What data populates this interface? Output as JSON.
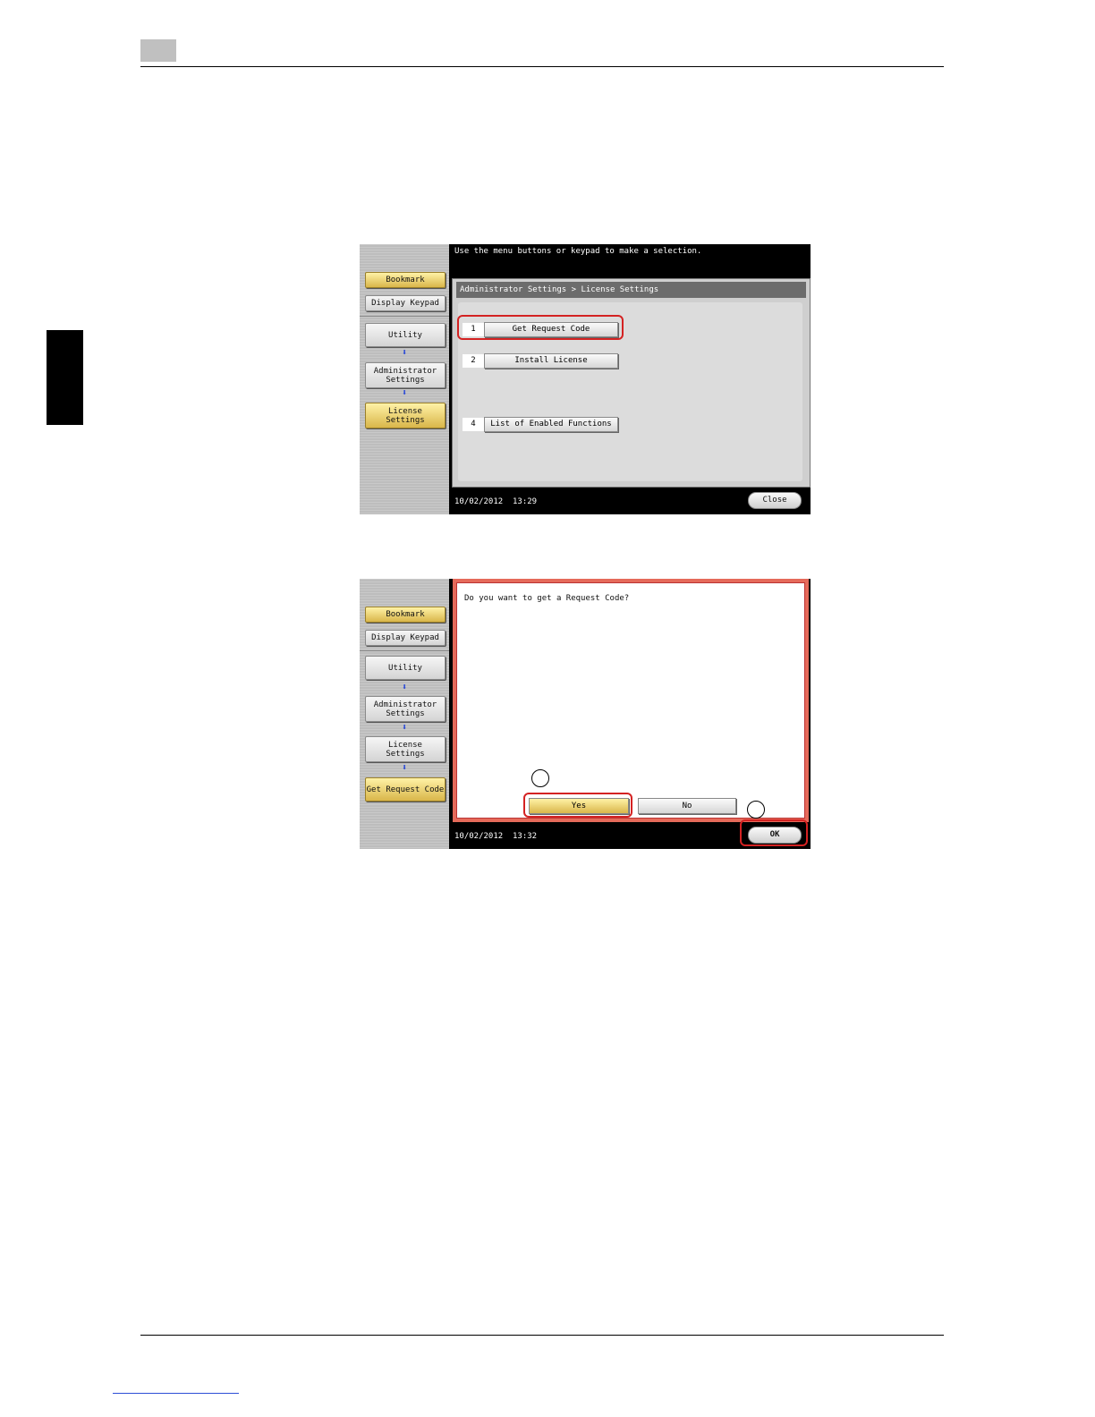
{
  "screen1": {
    "message": "Use the menu buttons or keypad to make a selection.",
    "sidebar": {
      "bookmark": "Bookmark",
      "display_keypad": "Display Keypad",
      "utility": "Utility",
      "admin_settings": "Administrator\nSettings",
      "license_settings": "License\nSettings"
    },
    "breadcrumb": "Administrator Settings > License Settings",
    "menu": [
      {
        "num": "1",
        "label": "Get Request Code"
      },
      {
        "num": "2",
        "label": "Install License"
      },
      {
        "num": "4",
        "label": "List of Enabled Functions"
      }
    ],
    "date": "10/02/2012",
    "time": "13:29",
    "close": "Close"
  },
  "screen2": {
    "sidebar": {
      "bookmark": "Bookmark",
      "display_keypad": "Display Keypad",
      "utility": "Utility",
      "admin_settings": "Administrator\nSettings",
      "license_settings": "License\nSettings",
      "get_request_code": "Get Request Code"
    },
    "question": "Do you want to get a Request Code?",
    "yes": "Yes",
    "no": "No",
    "date": "10/02/2012",
    "time": "13:32",
    "ok": "OK"
  }
}
